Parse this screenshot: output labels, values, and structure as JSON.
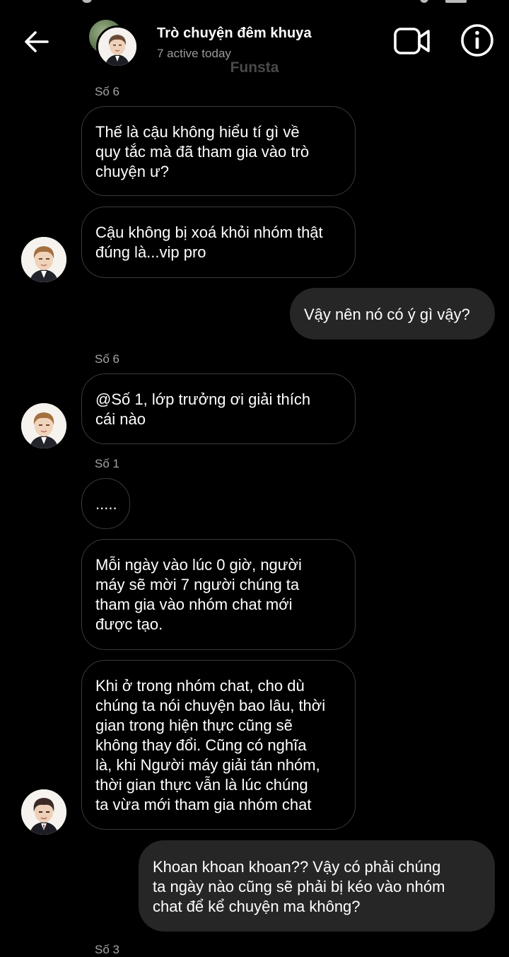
{
  "header": {
    "title": "Trò chuyện đêm khuya",
    "subtitle": "7 active today",
    "watermark": "Funsta",
    "icons": {
      "back": "arrow-left-icon",
      "video": "video-camera-icon",
      "info": "info-circle-icon"
    }
  },
  "colors": {
    "background": "#000000",
    "outgoing_bubble": "#262626",
    "incoming_border": "#3a3a3a",
    "secondary_text": "#9a9a9a"
  },
  "messages": {
    "m1": {
      "sender": "Số 6",
      "text": "Thế là cậu không hiểu tí gì về\nquy tắc mà đã tham gia vào trò\nchuyện ư?"
    },
    "m2": {
      "text": "Cậu không bị xoá khỏi nhóm thật\nđúng là...vip pro"
    },
    "m3": {
      "text": "Vậy nên nó có ý gì vậy?"
    },
    "m4": {
      "sender": "Số 6",
      "text": "@Số 1, lớp trưởng ơi giải thích\ncái nào"
    },
    "m5": {
      "sender": "Số 1",
      "text": "....."
    },
    "m6": {
      "text": "Mỗi ngày vào lúc 0 giờ, người\nmáy sẽ mời 7 người chúng ta\ntham gia vào nhóm chat mới\nđược tạo."
    },
    "m7": {
      "text": "Khi ở trong nhóm chat, cho dù\nchúng ta nói chuyện bao lâu, thời\ngian trong hiện thực cũng sẽ\nkhông thay đổi. Cũng có nghĩa\nlà, khi Người máy giải tán nhóm,\nthời gian thực vẫn là lúc chúng\nta vừa mới tham gia nhóm chat"
    },
    "m8": {
      "text": "Khoan khoan khoan?? Vậy có phải chúng\nta ngày nào cũng sẽ phải bị kéo vào nhóm\nchat để kể chuyện ma không?"
    },
    "m9": {
      "sender": "Số 3"
    }
  }
}
